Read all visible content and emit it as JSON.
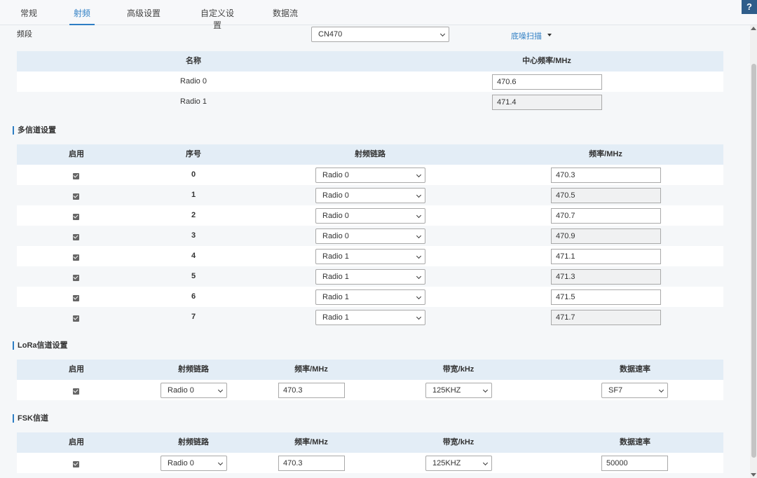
{
  "tabs": [
    {
      "label": "常规",
      "active": false
    },
    {
      "label": "射频",
      "active": true
    },
    {
      "label": "高级设置",
      "active": false
    },
    {
      "label": "自定义设置",
      "active": false
    },
    {
      "label": "数据流",
      "active": false
    }
  ],
  "help_label": "?",
  "band": {
    "label": "频段",
    "value": "CN470",
    "scan_link": "底噪扫描"
  },
  "radio_table": {
    "headers": [
      "名称",
      "中心频率/MHz"
    ],
    "rows": [
      {
        "name": "Radio 0",
        "freq": "470.6"
      },
      {
        "name": "Radio 1",
        "freq": "471.4"
      }
    ]
  },
  "multi_channel": {
    "title": "多信道设置",
    "headers": [
      "启用",
      "序号",
      "射频链路",
      "频率/MHz"
    ],
    "rows": [
      {
        "index": "0",
        "radio": "Radio 0",
        "freq": "470.3"
      },
      {
        "index": "1",
        "radio": "Radio 0",
        "freq": "470.5"
      },
      {
        "index": "2",
        "radio": "Radio 0",
        "freq": "470.7"
      },
      {
        "index": "3",
        "radio": "Radio 0",
        "freq": "470.9"
      },
      {
        "index": "4",
        "radio": "Radio 1",
        "freq": "471.1"
      },
      {
        "index": "5",
        "radio": "Radio 1",
        "freq": "471.3"
      },
      {
        "index": "6",
        "radio": "Radio 1",
        "freq": "471.5"
      },
      {
        "index": "7",
        "radio": "Radio 1",
        "freq": "471.7"
      }
    ]
  },
  "lora_channel": {
    "title": "LoRa信道设置",
    "headers": [
      "启用",
      "射频链路",
      "频率/MHz",
      "带宽/kHz",
      "数据速率"
    ],
    "row": {
      "radio": "Radio 0",
      "freq": "470.3",
      "bandwidth": "125KHZ",
      "rate": "SF7"
    }
  },
  "fsk_channel": {
    "title": "FSK信道",
    "headers": [
      "启用",
      "射频链路",
      "频率/MHz",
      "带宽/kHz",
      "数据速率"
    ],
    "row": {
      "radio": "Radio 0",
      "freq": "470.3",
      "bandwidth": "125KHZ",
      "rate": "50000"
    }
  }
}
